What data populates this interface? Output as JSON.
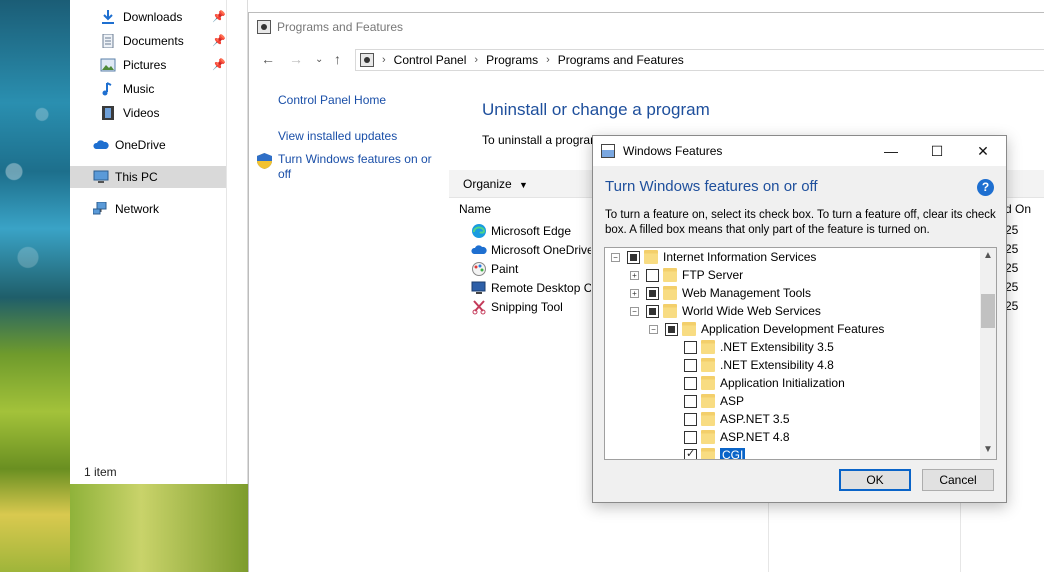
{
  "explorer": {
    "quick_access": [
      {
        "label": "Downloads",
        "icon": "download-arrow-icon",
        "pinned": true
      },
      {
        "label": "Documents",
        "icon": "documents-icon",
        "pinned": true
      },
      {
        "label": "Pictures",
        "icon": "pictures-icon",
        "pinned": true
      },
      {
        "label": "Music",
        "icon": "music-icon",
        "pinned": false
      },
      {
        "label": "Videos",
        "icon": "videos-icon",
        "pinned": false
      }
    ],
    "onedrive": "OneDrive",
    "this_pc": "This PC",
    "network": "Network",
    "status": "1 item"
  },
  "programs_features": {
    "title": "Programs and Features",
    "breadcrumb": [
      "Control Panel",
      "Programs",
      "Programs and Features"
    ],
    "side_links": [
      "Control Panel Home",
      "View installed updates",
      "Turn Windows features on or off"
    ],
    "heading": "Uninstall or change a program",
    "description": "To uninstall a program",
    "organize": "Organize",
    "column_name": "Name",
    "column_installed": "d On",
    "programs": [
      {
        "name": "Microsoft Edge",
        "date": "25"
      },
      {
        "name": "Microsoft OneDrive",
        "date": "25"
      },
      {
        "name": "Paint",
        "date": "25"
      },
      {
        "name": "Remote Desktop Co",
        "date": "25"
      },
      {
        "name": "Snipping Tool",
        "date": "25"
      }
    ]
  },
  "dialog": {
    "title": "Windows Features",
    "heading": "Turn Windows features on or off",
    "help": "?",
    "description": "To turn a feature on, select its check box. To turn a feature off, clear its check box. A filled box means that only part of the feature is turned on.",
    "features": [
      {
        "label": "Internet Information Services",
        "level": 0,
        "expander": "minus",
        "state": "partial"
      },
      {
        "label": "FTP Server",
        "level": 1,
        "expander": "plus",
        "state": "unchecked"
      },
      {
        "label": "Web Management Tools",
        "level": 1,
        "expander": "plus",
        "state": "partial"
      },
      {
        "label": "World Wide Web Services",
        "level": 1,
        "expander": "minus",
        "state": "partial"
      },
      {
        "label": "Application Development Features",
        "level": 2,
        "expander": "minus",
        "state": "partial"
      },
      {
        "label": ".NET Extensibility 3.5",
        "level": 3,
        "expander": "none",
        "state": "unchecked"
      },
      {
        "label": ".NET Extensibility 4.8",
        "level": 3,
        "expander": "none",
        "state": "unchecked"
      },
      {
        "label": "Application Initialization",
        "level": 3,
        "expander": "none",
        "state": "unchecked"
      },
      {
        "label": "ASP",
        "level": 3,
        "expander": "none",
        "state": "unchecked"
      },
      {
        "label": "ASP.NET 3.5",
        "level": 3,
        "expander": "none",
        "state": "unchecked"
      },
      {
        "label": "ASP.NET 4.8",
        "level": 3,
        "expander": "none",
        "state": "unchecked"
      },
      {
        "label": "CGI",
        "level": 3,
        "expander": "none",
        "state": "checked",
        "selected": true
      }
    ],
    "ok": "OK",
    "cancel": "Cancel"
  }
}
